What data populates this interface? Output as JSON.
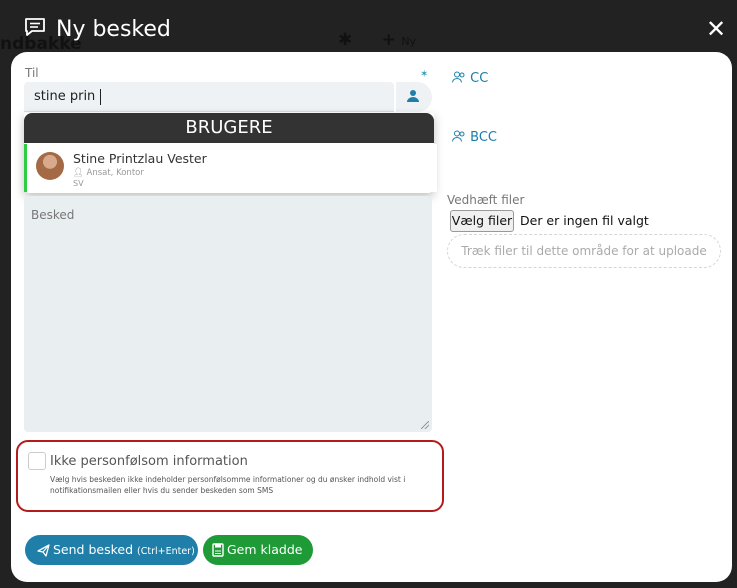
{
  "header": {
    "title": "Ny besked",
    "close_glyph": "✕",
    "background_fragment": "ndbakke",
    "background_new": "Ny"
  },
  "to": {
    "label": "Til",
    "value": "stine prin"
  },
  "dropdown": {
    "heading": "BRUGERE",
    "user": {
      "name": "Stine Printzlau Vester",
      "role": "Ansat, Kontor",
      "initials": "SV"
    }
  },
  "cc_label": "CC",
  "bcc_label": "BCC",
  "message": {
    "placeholder": "Besked"
  },
  "attachments": {
    "label": "Vedhæft filer",
    "choose_button": "Vælg filer",
    "no_file": "Der er ingen fil valgt",
    "drop_zone": "Træk filer til dette område for at uploade"
  },
  "sensitive": {
    "label": "Ikke personfølsom information",
    "description": "Vælg hvis beskeden ikke indeholder personfølsomme informationer og du ønsker indhold vist i notifikationsmailen eller hvis du sender beskeden som SMS",
    "checked": false
  },
  "actions": {
    "send_label": "Send besked",
    "send_shortcut": "(Ctrl+Enter)",
    "draft_label": "Gem kladde"
  },
  "colors": {
    "accent_blue": "#1f7fa8",
    "draft_green": "#1e9a36",
    "highlight_red": "#b31b1b",
    "header_dark": "#222222"
  },
  "icons": [
    "speech-bubble-icon",
    "close-icon",
    "user-lookup-icon",
    "user-group-icon",
    "paper-plane-icon",
    "save-icon"
  ]
}
